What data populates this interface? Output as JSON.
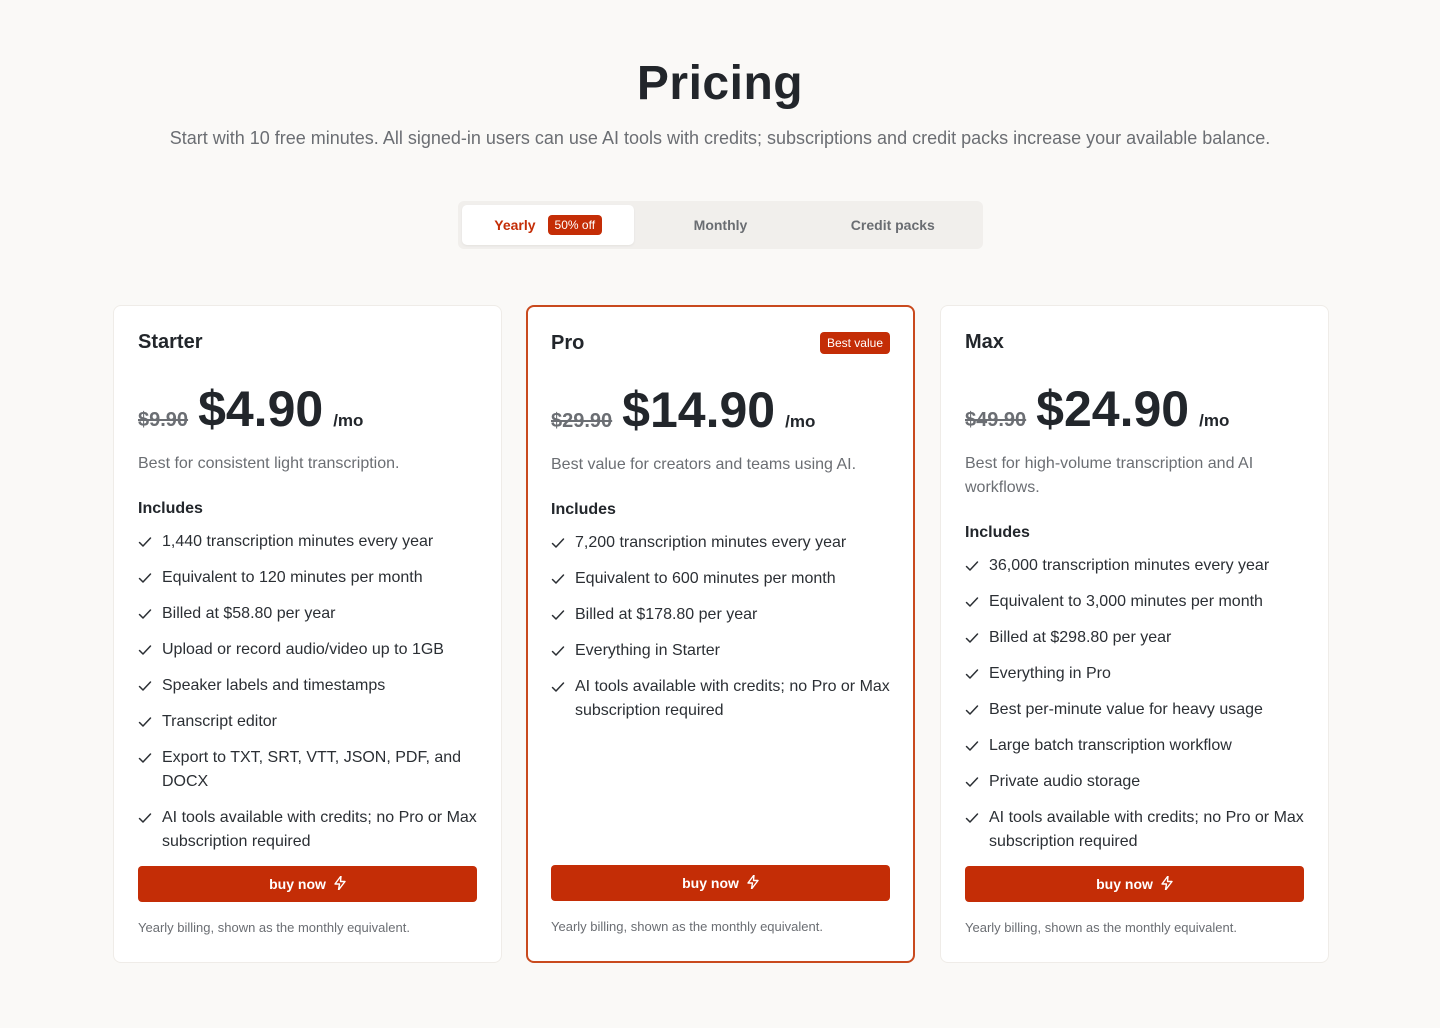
{
  "header": {
    "title": "Pricing",
    "subtitle": "Start with 10 free minutes. All signed-in users can use AI tools with credits; subscriptions and credit packs increase your available balance."
  },
  "toggle": {
    "yearly": "Yearly",
    "yearly_badge": "50% off",
    "monthly": "Monthly",
    "credit_packs": "Credit packs",
    "selected": "Yearly"
  },
  "colors": {
    "accent": "#c42d06",
    "featured_border": "#c94a1e",
    "background": "#faf9f7"
  },
  "plans": [
    {
      "name": "Starter",
      "old_price": "$9.90",
      "price": "$4.90",
      "per": "/mo",
      "description": "Best for consistent light transcription.",
      "includes_label": "Includes",
      "features": [
        "1,440 transcription minutes every year",
        "Equivalent to 120 minutes per month",
        "Billed at $58.80 per year",
        "Upload or record audio/video up to 1GB",
        "Speaker labels and timestamps",
        "Transcript editor",
        "Export to TXT, SRT, VTT, JSON, PDF, and DOCX",
        "AI tools available with credits; no Pro or Max subscription required"
      ],
      "button": "buy now",
      "note": "Yearly billing, shown as the monthly equivalent."
    },
    {
      "name": "Pro",
      "badge": "Best value",
      "old_price": "$29.90",
      "price": "$14.90",
      "per": "/mo",
      "description": "Best value for creators and teams using AI.",
      "includes_label": "Includes",
      "features": [
        "7,200 transcription minutes every year",
        "Equivalent to 600 minutes per month",
        "Billed at $178.80 per year",
        "Everything in Starter",
        "AI tools available with credits; no Pro or Max subscription required"
      ],
      "button": "buy now",
      "note": "Yearly billing, shown as the monthly equivalent."
    },
    {
      "name": "Max",
      "old_price": "$49.90",
      "price": "$24.90",
      "per": "/mo",
      "description": "Best for high-volume transcription and AI workflows.",
      "includes_label": "Includes",
      "features": [
        "36,000 transcription minutes every year",
        "Equivalent to 3,000 minutes per month",
        "Billed at $298.80 per year",
        "Everything in Pro",
        "Best per-minute value for heavy usage",
        "Large batch transcription workflow",
        "Private audio storage",
        "AI tools available with credits; no Pro or Max subscription required"
      ],
      "button": "buy now",
      "note": "Yearly billing, shown as the monthly equivalent."
    }
  ]
}
